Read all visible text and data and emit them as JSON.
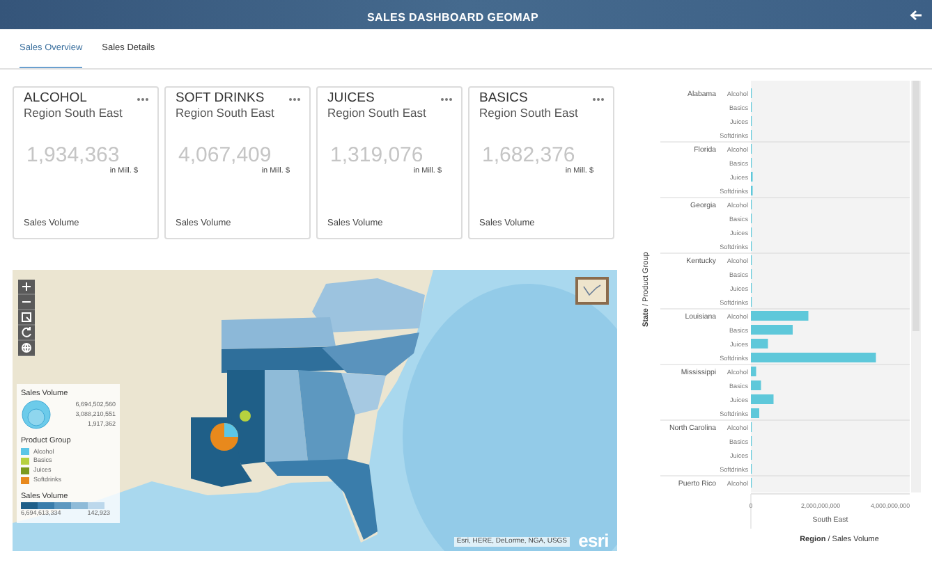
{
  "header": {
    "title": "SALES DASHBOARD GEOMAP"
  },
  "tabs": [
    {
      "label": "Sales Overview",
      "selected": true
    },
    {
      "label": "Sales Details",
      "selected": false
    }
  ],
  "cards": [
    {
      "title": "ALCOHOL",
      "subtitle": "Region South East",
      "value": "1,934,363",
      "unit": "in Mill. $",
      "footer": "Sales Volume"
    },
    {
      "title": "SOFT DRINKS",
      "subtitle": "Region South East",
      "value": "4,067,409",
      "unit": "in Mill. $",
      "footer": "Sales Volume"
    },
    {
      "title": "JUICES",
      "subtitle": "Region South East",
      "value": "1,319,076",
      "unit": "in Mill. $",
      "footer": "Sales Volume"
    },
    {
      "title": "BASICS",
      "subtitle": "Region South East",
      "value": "1,682,376",
      "unit": "in Mill. $",
      "footer": "Sales Volume"
    }
  ],
  "map": {
    "kind": "picture",
    "legend": {
      "size_title": "Sales Volume",
      "size_values": [
        "6,694,502,560",
        "3,088,210,551",
        "1,917,362"
      ],
      "group_title": "Product Group",
      "groups": [
        {
          "label": "Alcohol",
          "color": "#5cc6e6"
        },
        {
          "label": "Basics",
          "color": "#b7d13f"
        },
        {
          "label": "Juices",
          "color": "#7c9a1c"
        },
        {
          "label": "Softdrinks",
          "color": "#e8891c"
        }
      ],
      "volume_title": "Sales Volume",
      "volume_values": [
        "6,694,613,334",
        "142,923"
      ]
    },
    "attribution": "Esri, HERE, DeLorme, NGA, USGS",
    "logo": "esri"
  },
  "chart": {
    "chart_data": {
      "type": "bar",
      "orientation": "horizontal",
      "ylabel": "**State** / Product Group",
      "xlabel": "**Region** / Sales Volume",
      "xlim": [
        0,
        4560000000
      ],
      "xticks": [
        {
          "value": 0,
          "label": "0"
        },
        {
          "value": 2000000000,
          "label": "2,000,000,000"
        },
        {
          "value": 4000000000,
          "label": "4,000,000,000"
        }
      ],
      "categories": [
        "Alcohol",
        "Basics",
        "Juices",
        "Softdrinks",
        "Alcohol",
        "Basics",
        "Juices",
        "Softdrinks",
        "Alcohol",
        "Basics",
        "Juices",
        "Softdrinks",
        "Alcohol",
        "Basics",
        "Juices",
        "Softdrinks",
        "Alcohol",
        "Basics",
        "Juices",
        "Softdrinks",
        "Alcohol",
        "Basics",
        "Juices",
        "Softdrinks",
        "Alcohol",
        "Basics",
        "Juices",
        "Softdrinks",
        "Alcohol"
      ],
      "series": [
        {
          "name": "South East",
          "color": "#5ec8da",
          "values": [
            0,
            0,
            0,
            0,
            0,
            0,
            50000000,
            50000000,
            0,
            0,
            0,
            0,
            0,
            0,
            0,
            0,
            1650000000,
            1200000000,
            490000000,
            3590000000,
            150000000,
            290000000,
            650000000,
            240000000,
            0,
            0,
            0,
            0,
            0
          ]
        }
      ],
      "annotations": [
        "Alabama",
        "Florida",
        "Georgia",
        "Kentucky",
        "Louisiana",
        "Mississippi",
        "North Carolina",
        "Puerto Rico"
      ]
    }
  }
}
